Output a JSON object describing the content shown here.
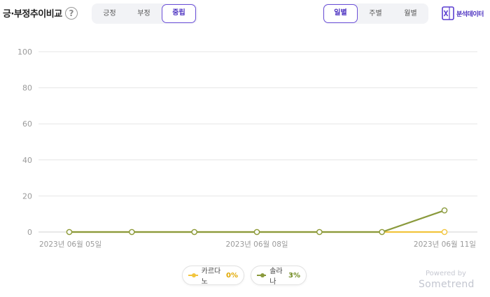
{
  "header": {
    "title": "긍·부정추이비교",
    "help_icon": "question-icon",
    "sentiment_tabs": [
      {
        "label": "긍정",
        "active": false
      },
      {
        "label": "부정",
        "active": false
      },
      {
        "label": "중립",
        "active": true
      }
    ],
    "period_tabs": [
      {
        "label": "일별",
        "active": true
      },
      {
        "label": "주별",
        "active": false
      },
      {
        "label": "월별",
        "active": false
      }
    ],
    "export_label": "분석데이터",
    "export_icon": "excel-icon"
  },
  "colors": {
    "accent": "#5b3fd0",
    "series_1": "#f2c53d",
    "series_2": "#8a9a3c",
    "grid": "#e6e6e6"
  },
  "chart_data": {
    "type": "line",
    "x": [
      "2023-06-05",
      "2023-06-06",
      "2023-06-07",
      "2023-06-08",
      "2023-06-09",
      "2023-06-10",
      "2023-06-11"
    ],
    "xtick_labels": [
      "2023년 06월 05일",
      "2023년 06월 08일",
      "2023년 06월 11일"
    ],
    "xtick_positions": [
      "2023-06-05",
      "2023-06-08",
      "2023-06-11"
    ],
    "ylim": [
      0,
      100
    ],
    "yticks": [
      0,
      20,
      40,
      60,
      80,
      100
    ],
    "grid": true,
    "legend_position": "bottom",
    "series": [
      {
        "name": "카르다노",
        "values": [
          0,
          0,
          0,
          0,
          0,
          0,
          0
        ],
        "summary": "0%",
        "color": "#f2c53d"
      },
      {
        "name": "솔라나",
        "values": [
          0,
          0,
          0,
          0,
          0,
          0,
          12
        ],
        "summary": "3%",
        "color": "#8a9a3c"
      }
    ]
  },
  "footer": {
    "powered_by": "Powered by",
    "brand": "Sometrend"
  }
}
